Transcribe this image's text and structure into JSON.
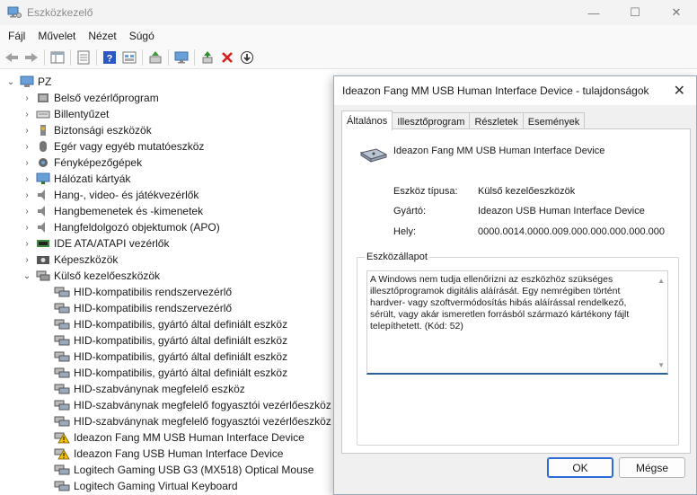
{
  "window": {
    "title": "Eszközkezelő",
    "controls": {
      "minimize": "—",
      "maximize": "☐",
      "close": "✕"
    }
  },
  "menu": [
    "Fájl",
    "Művelet",
    "Nézet",
    "Súgó"
  ],
  "toolbar_icons": [
    "back-icon",
    "forward-icon",
    "show-hide-tree-icon",
    "properties-icon",
    "help-icon",
    "view-icon",
    "update-driver-icon",
    "monitor-icon",
    "enable-device-icon",
    "uninstall-icon",
    "download-icon"
  ],
  "tree": {
    "root": "PZ",
    "categories": [
      {
        "label": "Belső vezérlőprogram",
        "icon": "firmware-icon"
      },
      {
        "label": "Billentyűzet",
        "icon": "keyboard-icon"
      },
      {
        "label": "Biztonsági eszközök",
        "icon": "security-icon"
      },
      {
        "label": "Egér vagy egyéb mutatóeszköz",
        "icon": "mouse-icon"
      },
      {
        "label": "Fényképezőgépek",
        "icon": "camera-icon"
      },
      {
        "label": "Hálózati kártyák",
        "icon": "network-icon"
      },
      {
        "label": "Hang-, video- és játékvezérlők",
        "icon": "speaker-icon"
      },
      {
        "label": "Hangbemenetek és -kimenetek",
        "icon": "speaker-icon"
      },
      {
        "label": "Hangfeldolgozó objektumok (APO)",
        "icon": "speaker-icon"
      },
      {
        "label": "IDE ATA/ATAPI vezérlők",
        "icon": "ide-icon"
      },
      {
        "label": "Képeszközök",
        "icon": "imaging-icon"
      },
      {
        "label": "Külső kezelőeszközök",
        "icon": "hid-icon"
      }
    ],
    "hid_children": [
      {
        "label": "HID-kompatibilis rendszervezérlő",
        "warn": false
      },
      {
        "label": "HID-kompatibilis rendszervezérlő",
        "warn": false
      },
      {
        "label": "HID-kompatibilis, gyártó által definiált eszköz",
        "warn": false
      },
      {
        "label": "HID-kompatibilis, gyártó által definiált eszköz",
        "warn": false
      },
      {
        "label": "HID-kompatibilis, gyártó által definiált eszköz",
        "warn": false
      },
      {
        "label": "HID-kompatibilis, gyártó által definiált eszköz",
        "warn": false
      },
      {
        "label": "HID-szabványnak megfelelő eszköz",
        "warn": false
      },
      {
        "label": "HID-szabványnak megfelelő fogyasztói vezérlőeszköz",
        "warn": false
      },
      {
        "label": "HID-szabványnak megfelelő fogyasztói vezérlőeszköz",
        "warn": false
      },
      {
        "label": "Ideazon Fang MM USB Human Interface Device",
        "warn": true
      },
      {
        "label": "Ideazon Fang USB Human Interface Device",
        "warn": true
      },
      {
        "label": "Logitech Gaming USB G3 (MX518) Optical Mouse",
        "warn": false
      },
      {
        "label": "Logitech Gaming Virtual Keyboard",
        "warn": false
      }
    ]
  },
  "dialog": {
    "title": "Ideazon Fang MM USB Human Interface Device - tulajdonságok",
    "close": "✕",
    "tabs": [
      "Általános",
      "Illesztőprogram",
      "Részletek",
      "Események"
    ],
    "device_name": "Ideazon Fang MM USB Human Interface Device",
    "props": [
      {
        "label": "Eszköz típusa:",
        "value": "Külső kezelőeszközök"
      },
      {
        "label": "Gyártó:",
        "value": "Ideazon USB Human Interface Device"
      },
      {
        "label": "Hely:",
        "value": "0000.0014.0000.009.000.000.000.000.000"
      }
    ],
    "status_group": "Eszközállapot",
    "status_text": "A Windows nem tudja ellenőrizni az eszközhöz szükséges illesztőprogramok digitális aláírását. Egy nemrégiben történt hardver- vagy szoftvermódosítás hibás aláírással rendelkező, sérült, vagy akár ismeretlen forrásból származó kártékony fájlt telepíthetett. (Kód: 52)",
    "ok": "OK",
    "cancel": "Mégse"
  }
}
